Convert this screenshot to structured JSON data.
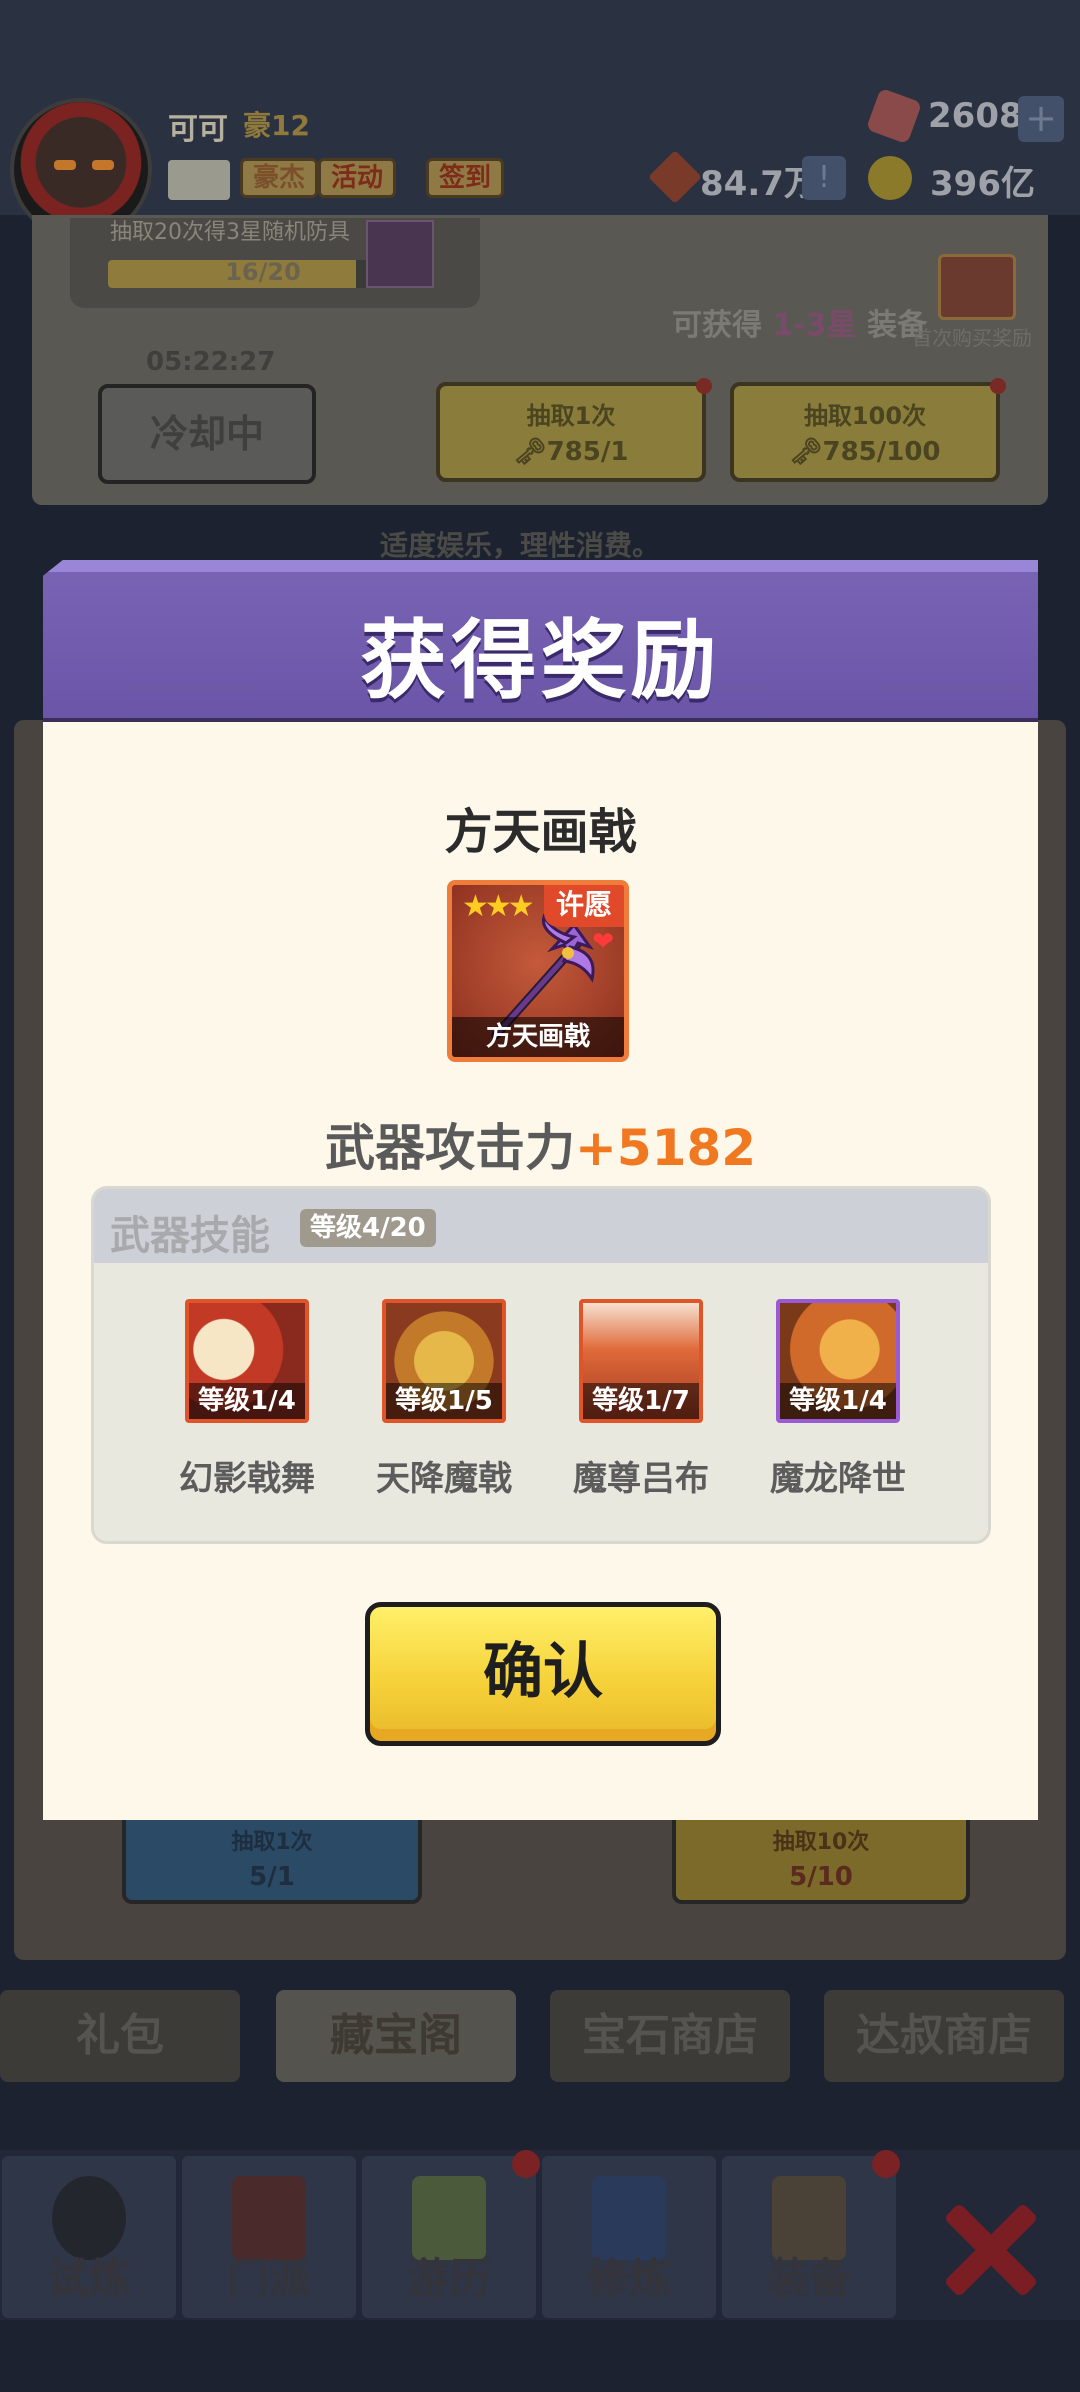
{
  "player": {
    "name": "可可",
    "title": "豪12",
    "buttons": [
      "豪杰",
      "活动",
      "签到"
    ]
  },
  "resources": {
    "gems": "2608",
    "power": "84.7万",
    "gold": "396亿"
  },
  "treasure_box": {
    "progress_label": "抽取20次得3星随机防具",
    "progress_text": "16/20",
    "progress_fraction": 0.8,
    "mystery_count": "1",
    "obtain_prefix": "可获得 ",
    "obtain_highlight": "1-3星",
    "obtain_suffix": " 装备",
    "first_reward": "首次购买奖励",
    "timer": "05:22:27",
    "cooldown_label": "冷却中",
    "draw_one": {
      "label": "抽取1次",
      "cost": "🗝785/1"
    },
    "draw_hundred": {
      "label": "抽取100次",
      "cost": "🗝785/100"
    },
    "slogan": "适度娱乐，理性消费。"
  },
  "lower_draw": {
    "left": {
      "label": "抽取1次",
      "cost": "5/1"
    },
    "right": {
      "label": "抽取10次",
      "cost": "5/10"
    }
  },
  "shop_tabs": [
    "礼包",
    "藏宝阁",
    "宝石商店",
    "达叔商店"
  ],
  "nav": [
    "试炼",
    "门派",
    "游历",
    "修炼",
    "装备"
  ],
  "modal": {
    "title": "获得奖励",
    "item_name": "方天画戟",
    "card_label": "方天画戟",
    "stars": "★★★",
    "wish_tag": "许愿",
    "attack_label": "武器攻击力",
    "attack_bonus": "+5182",
    "skills_title": "武器技能",
    "skills_level": "等级4/20",
    "skills": [
      {
        "name": "幻影戟舞",
        "level": "等级1/4"
      },
      {
        "name": "天降魔戟",
        "level": "等级1/5"
      },
      {
        "name": "魔尊吕布",
        "level": "等级1/7"
      },
      {
        "name": "魔龙降世",
        "level": "等级1/4"
      }
    ],
    "confirm_label": "确认"
  }
}
